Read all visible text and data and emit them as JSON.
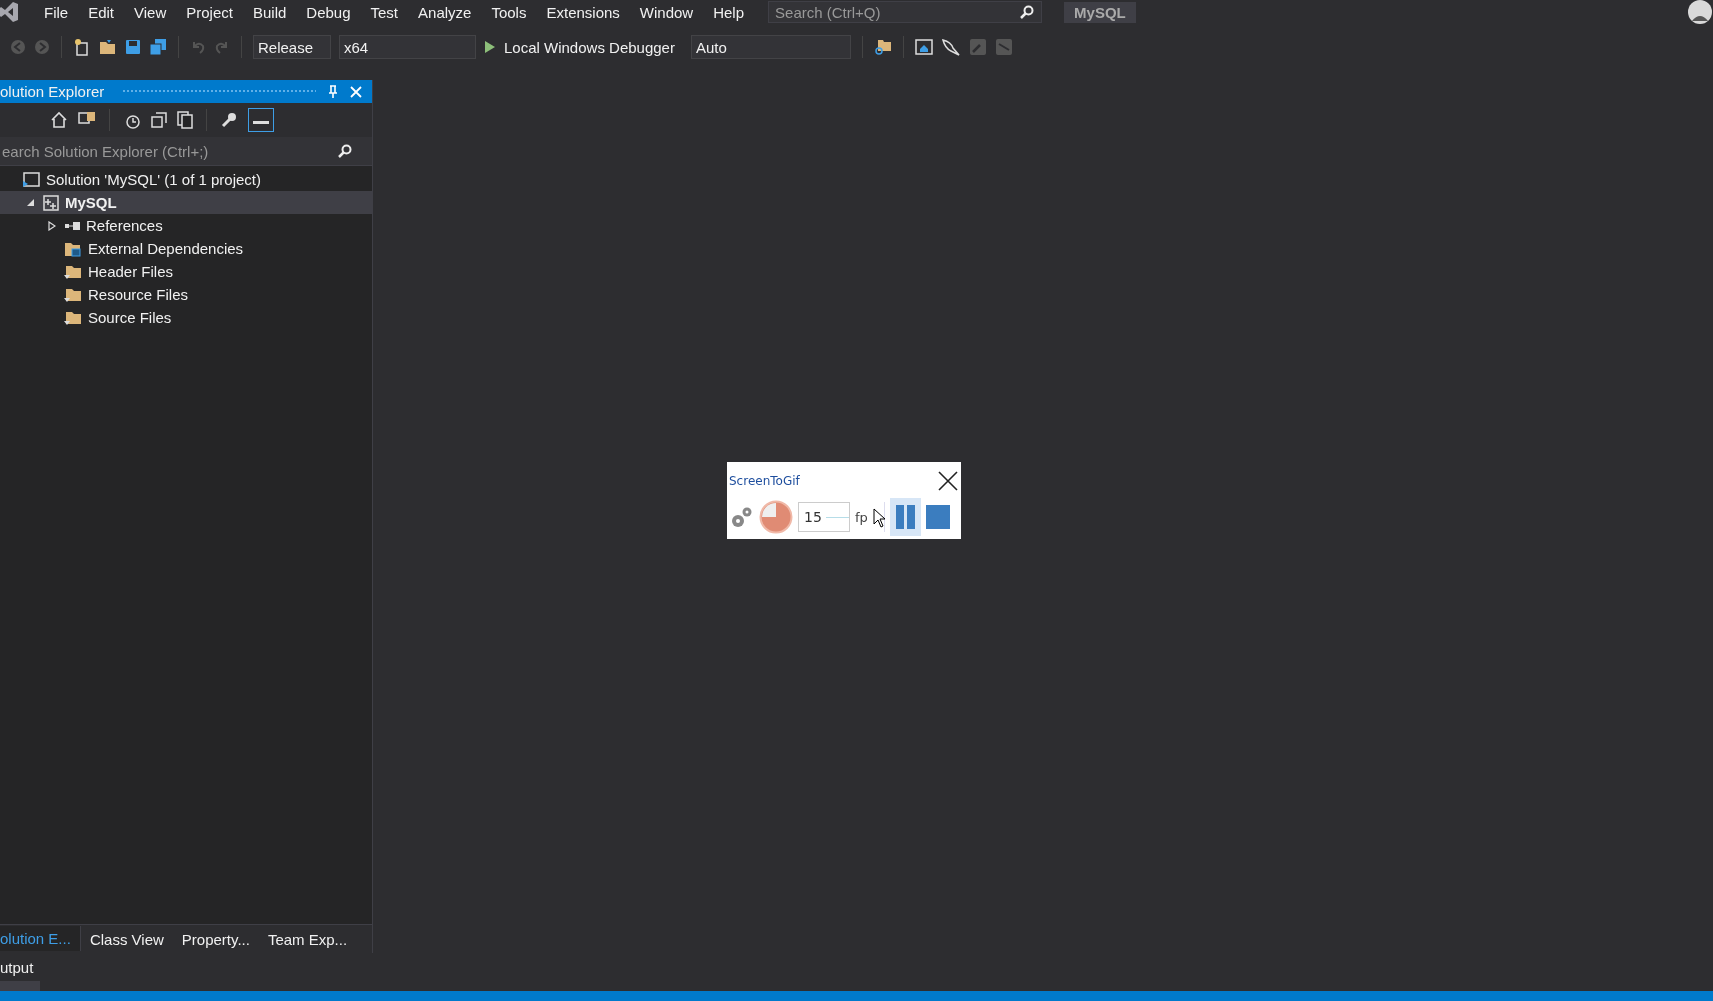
{
  "menu_bar": {
    "items": [
      "File",
      "Edit",
      "View",
      "Project",
      "Build",
      "Debug",
      "Test",
      "Analyze",
      "Tools",
      "Extensions",
      "Window",
      "Help"
    ],
    "search": {
      "placeholder": "Search (Ctrl+Q)"
    },
    "solution_name": "MySQL"
  },
  "toolbar": {
    "configuration": "Release",
    "platform": "x64",
    "debugger": "Local Windows Debugger",
    "stack_frame": "Auto"
  },
  "solution_explorer": {
    "title": "olution Explorer",
    "search": {
      "placeholder": "earch Solution Explorer (Ctrl+;)"
    },
    "tree": [
      {
        "label": "Solution 'MySQL' (1 of 1 project)",
        "kind": "solution",
        "selected": false,
        "children": [
          {
            "label": "MySQL",
            "kind": "project",
            "selected": true,
            "expanded": true,
            "children": [
              {
                "label": "References",
                "kind": "references",
                "selected": false,
                "expanded": false
              },
              {
                "label": "External Dependencies",
                "kind": "external",
                "selected": false
              },
              {
                "label": "Header Files",
                "kind": "filter",
                "selected": false
              },
              {
                "label": "Resource Files",
                "kind": "filter",
                "selected": false
              },
              {
                "label": "Source Files",
                "kind": "filter",
                "selected": false
              }
            ]
          }
        ]
      }
    ],
    "tabs": [
      {
        "label": "olution E...",
        "selected": true
      },
      {
        "label": "Class View",
        "selected": false
      },
      {
        "label": "Property...",
        "selected": false
      },
      {
        "label": "Team Exp...",
        "selected": false
      }
    ]
  },
  "bottom_tabs": [
    {
      "label": "utput",
      "selected": false
    }
  ],
  "recorder": {
    "title": "ScreenToGif",
    "fps": "15",
    "fps_label": "fp",
    "paused": true
  }
}
